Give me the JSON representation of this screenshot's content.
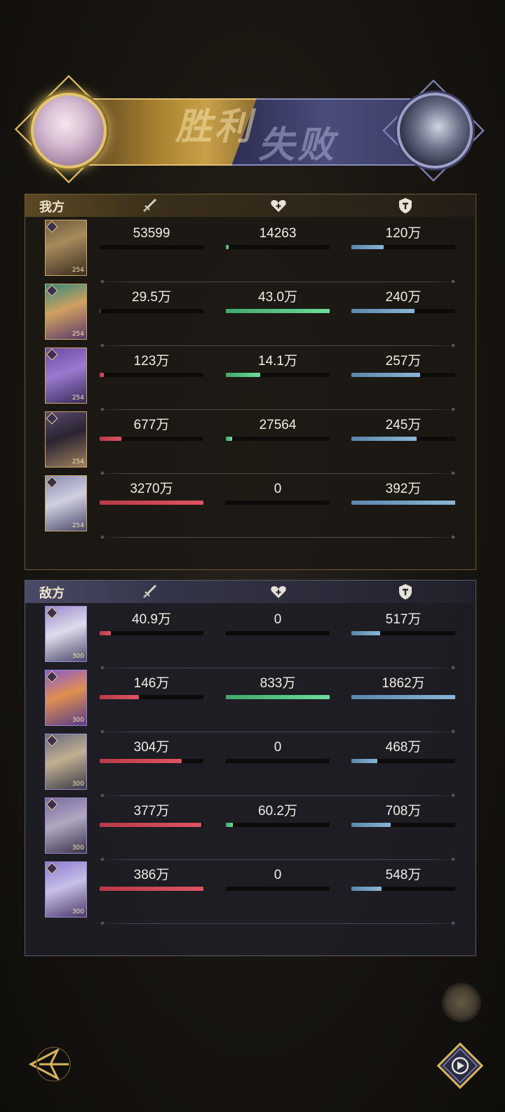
{
  "banner": {
    "win_label": "胜利",
    "lose_label": "失败"
  },
  "headers": {
    "icons": [
      "sword-icon",
      "heart-icon",
      "shield-icon"
    ]
  },
  "colors": {
    "attack_bar": "#e05462",
    "heal_bar": "#6edc9a",
    "defense_bar": "#8ab6d6",
    "gold_accent": "#d8b55c",
    "purple_accent": "#7d80b0"
  },
  "ours": {
    "label": "我方",
    "rows": [
      {
        "level": "254",
        "damage": "53599",
        "damage_pct": 0.0,
        "heal": "14263",
        "heal_pct": 0.03,
        "taken": "120万",
        "taken_pct": 0.31
      },
      {
        "level": "254",
        "damage": "29.5万",
        "damage_pct": 0.01,
        "heal": "43.0万",
        "heal_pct": 1.0,
        "taken": "240万",
        "taken_pct": 0.61
      },
      {
        "level": "254",
        "damage": "123万",
        "damage_pct": 0.04,
        "heal": "14.1万",
        "heal_pct": 0.33,
        "taken": "257万",
        "taken_pct": 0.66
      },
      {
        "level": "254",
        "damage": "677万",
        "damage_pct": 0.21,
        "heal": "27564",
        "heal_pct": 0.06,
        "taken": "245万",
        "taken_pct": 0.63
      },
      {
        "level": "254",
        "damage": "3270万",
        "damage_pct": 1.0,
        "heal": "0",
        "heal_pct": 0.0,
        "taken": "392万",
        "taken_pct": 1.0
      }
    ]
  },
  "enemy": {
    "label": "敌方",
    "rows": [
      {
        "level": "300",
        "damage": "40.9万",
        "damage_pct": 0.11,
        "heal": "0",
        "heal_pct": 0.0,
        "taken": "517万",
        "taken_pct": 0.28
      },
      {
        "level": "300",
        "damage": "146万",
        "damage_pct": 0.38,
        "heal": "833万",
        "heal_pct": 1.0,
        "taken": "1862万",
        "taken_pct": 1.0
      },
      {
        "level": "300",
        "damage": "304万",
        "damage_pct": 0.79,
        "heal": "0",
        "heal_pct": 0.0,
        "taken": "468万",
        "taken_pct": 0.25
      },
      {
        "level": "300",
        "damage": "377万",
        "damage_pct": 0.98,
        "heal": "60.2万",
        "heal_pct": 0.07,
        "taken": "708万",
        "taken_pct": 0.38
      },
      {
        "level": "300",
        "damage": "386万",
        "damage_pct": 1.0,
        "heal": "0",
        "heal_pct": 0.0,
        "taken": "548万",
        "taken_pct": 0.29
      }
    ]
  }
}
